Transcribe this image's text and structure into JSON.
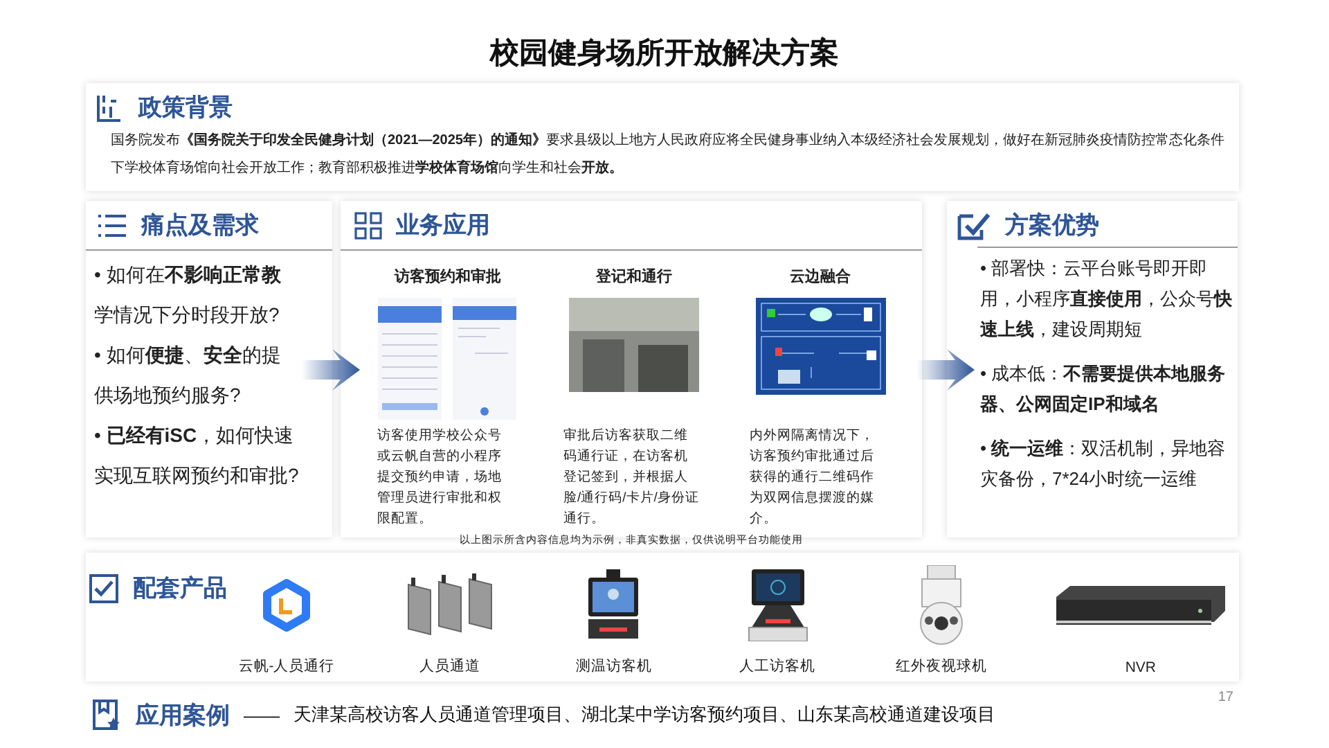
{
  "title": "校园健身场所开放解决方案",
  "policy": {
    "heading": "政策背景",
    "text": "国务院发布**《国务院关于印发全民健身计划（2021—2025年）的通知》**要求县级以上地方人民政府应将全民健身事业纳入本级经济社会发展规划，做好在新冠肺炎疫情防控常态化条件下学校体育场馆向社会开放工作；教育部积极推进**学校体育场馆**向学生和社会**开放。**"
  },
  "pain_points": {
    "heading": "痛点及需求",
    "items": [
      "• 如何在**不影响正常教**学情况下分时段开放?",
      "• 如何**便捷**、**安全**的提供场地预约服务?",
      "• **已经有iSC**，如何快速实现互联网预约和审批?"
    ]
  },
  "business": {
    "heading": "业务应用",
    "apps": [
      {
        "title": "访客预约和审批",
        "kind": "phones",
        "description": "访客使用学校公众号或云帆自营的小程序提交预约申请，场地管理员进行审批和权限配置。"
      },
      {
        "title": "登记和通行",
        "kind": "photo",
        "description": "审批后访客获取二维码通行证，在访客机登记签到，并根据人脸/通行码/卡片/身份证通行。"
      },
      {
        "title": "云边融合",
        "kind": "diagram",
        "description": "内外网隔离情况下，访客预约审批通过后获得的通行二维码作为双网信息摆渡的媒介。"
      }
    ],
    "note": "以上图示所含内容信息均为示例，非真实数据，仅供说明平台功能使用"
  },
  "advantages": {
    "heading": "方案优势",
    "items": [
      "• 部署快：云平台账号即开即用，小程序**直接使用**，公众号**快速上线**，建设周期短",
      "• 成本低：**不需要提供本地服务器、公网固定IP和域名**",
      "• **统一运维**：双活机制，异地容灾备份，7*24小时统一运维"
    ]
  },
  "products": {
    "heading": "配套产品",
    "items": [
      {
        "name": "云帆-人员通行",
        "kind": "logo"
      },
      {
        "name": "人员通道",
        "kind": "gates"
      },
      {
        "name": "测温访客机",
        "kind": "terminal"
      },
      {
        "name": "人工访客机",
        "kind": "kiosk"
      },
      {
        "name": "红外夜视球机",
        "kind": "dome"
      },
      {
        "name": "NVR",
        "kind": "recorder"
      }
    ]
  },
  "cases": {
    "heading": "应用案例",
    "dash": "——",
    "text": "天津某高校访客人员通道管理项目、湖北某中学访客预约项目、山东某高校通道建设项目"
  },
  "page_number": "17"
}
